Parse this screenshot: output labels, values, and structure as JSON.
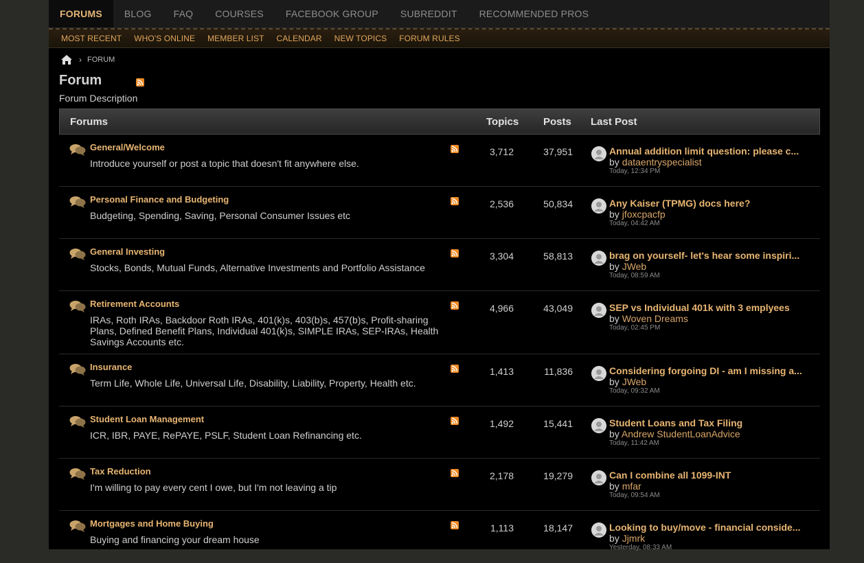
{
  "topnav": {
    "items": [
      "FORUMS",
      "BLOG",
      "FAQ",
      "COURSES",
      "FACEBOOK GROUP",
      "SUBREDDIT",
      "RECOMMENDED PROS"
    ]
  },
  "subnav": {
    "items": [
      "MOST RECENT",
      "WHO'S ONLINE",
      "MEMBER LIST",
      "CALENDAR",
      "NEW TOPICS",
      "FORUM RULES"
    ]
  },
  "breadcrumb": {
    "current": "FORUM"
  },
  "page": {
    "title": "Forum",
    "description": "Forum Description"
  },
  "table": {
    "headers": {
      "forums": "Forums",
      "topics": "Topics",
      "posts": "Posts",
      "last_post": "Last Post"
    },
    "rows": [
      {
        "name": "General/Welcome",
        "description": "Introduce yourself or post a topic that doesn't fit anywhere else.",
        "topics": "3,712",
        "posts": "37,951",
        "last_title": "Annual addition limit question: please c...",
        "by": "by ",
        "user": "dataentryspecialist",
        "time": "Today, 12:34 PM"
      },
      {
        "name": "Personal Finance and Budgeting",
        "description": "Budgeting, Spending, Saving, Personal Consumer Issues etc",
        "topics": "2,536",
        "posts": "50,834",
        "last_title": "Any Kaiser (TPMG) docs here?",
        "by": "by ",
        "user": "jfoxcpacfp",
        "time": "Today, 04:42 AM"
      },
      {
        "name": "General Investing",
        "description": "Stocks, Bonds, Mutual Funds, Alternative Investments and Portfolio Assistance",
        "topics": "3,304",
        "posts": "58,813",
        "last_title": "brag on yourself- let's hear some inspiri...",
        "by": "by ",
        "user": "JWeb",
        "time": "Today, 08:59 AM"
      },
      {
        "name": "Retirement Accounts",
        "description": "IRAs, Roth IRAs, Backdoor Roth IRAs, 401(k)s, 403(b)s, 457(b)s, Profit-sharing Plans, Defined Benefit Plans, Individual 401(k)s, SIMPLE IRAs, SEP-IRAs, Health Savings Accounts etc.",
        "topics": "4,966",
        "posts": "43,049",
        "last_title": "SEP vs Individual 401k with 3 emplyees",
        "by": "by ",
        "user": "Woven Dreams",
        "time": "Today, 02:45 PM"
      },
      {
        "name": "Insurance",
        "description": "Term Life, Whole Life, Universal Life, Disability, Liability, Property, Health etc.",
        "topics": "1,413",
        "posts": "11,836",
        "last_title": "Considering forgoing DI - am I missing a...",
        "by": "by ",
        "user": "JWeb",
        "time": "Today, 09:32 AM"
      },
      {
        "name": "Student Loan Management",
        "description": "ICR, IBR, PAYE, RePAYE, PSLF, Student Loan Refinancing etc.",
        "topics": "1,492",
        "posts": "15,441",
        "last_title": "Student Loans and Tax Filing",
        "by": "by ",
        "user": "Andrew StudentLoanAdvice",
        "time": "Today, 11:42 AM"
      },
      {
        "name": "Tax Reduction",
        "description": "I'm willing to pay every cent I owe, but I'm not leaving a tip",
        "topics": "2,178",
        "posts": "19,279",
        "last_title": "Can I combine all 1099-INT",
        "by": "by ",
        "user": "mfar",
        "time": "Today, 09:54 AM"
      },
      {
        "name": "Mortgages and Home Buying",
        "description": "Buying and financing your dream house",
        "topics": "1,113",
        "posts": "18,147",
        "last_title": "Looking to buy/move - financial conside...",
        "by": "by ",
        "user": "Jjmrk",
        "time": "Yesterday, 08:33 AM"
      }
    ]
  },
  "colors": {
    "accent": "#e8b572",
    "subnav_text": "#e0a65d",
    "rss": "#f08a24",
    "background": "#000000"
  },
  "icons": [
    "home-icon",
    "chevron-right-icon",
    "rss-icon",
    "speech-bubble-icon",
    "avatar"
  ]
}
